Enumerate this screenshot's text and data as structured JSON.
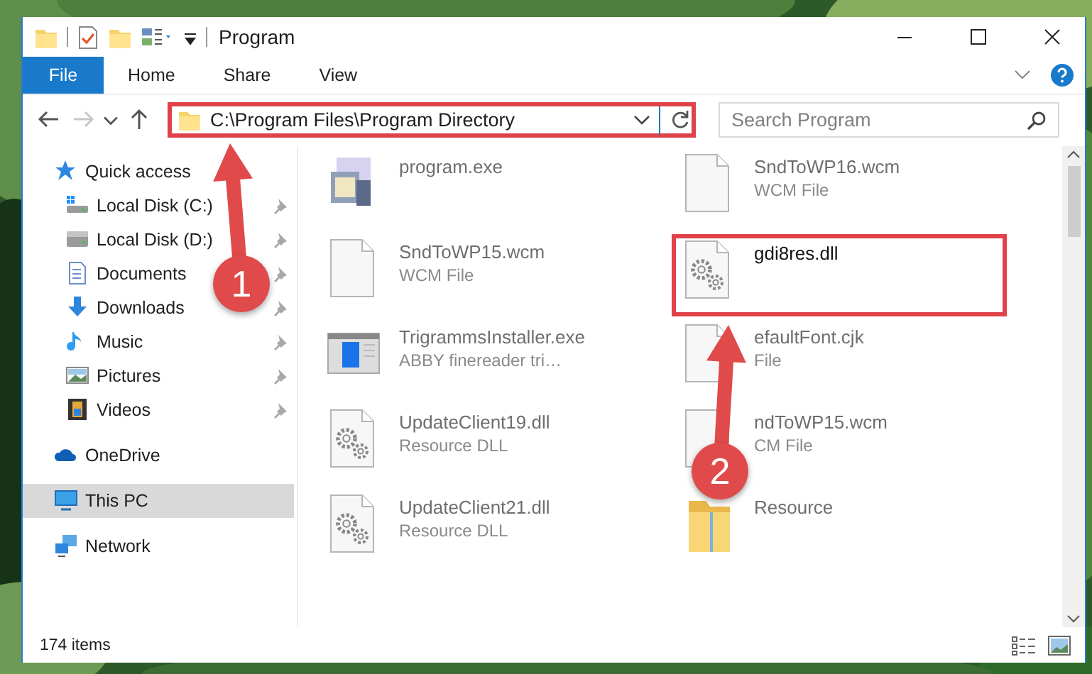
{
  "window": {
    "title": "Program"
  },
  "ribbon_tabs": [
    {
      "label": "File",
      "kind": "file"
    },
    {
      "label": "Home",
      "kind": "tab"
    },
    {
      "label": "Share",
      "kind": "tab"
    },
    {
      "label": "View",
      "kind": "tab"
    }
  ],
  "navigation": [
    {
      "kind": "back",
      "disabled": false
    },
    {
      "kind": "forward",
      "disabled": true
    },
    {
      "kind": "recent",
      "disabled": false
    },
    {
      "kind": "up",
      "disabled": false
    }
  ],
  "address_bar": {
    "path": "C:\\Program Files\\Program Directory",
    "highlighted": true
  },
  "search": {
    "placeholder": "Search Program"
  },
  "sidebar": {
    "items": [
      {
        "label": "Quick access",
        "kind": "star",
        "selected": false,
        "children": [
          {
            "label": "Local Disk (C:)",
            "kind": "system-drive",
            "pinned": true,
            "selected": false
          },
          {
            "label": "Local Disk (D:)",
            "kind": "drive",
            "pinned": true,
            "selected": false
          },
          {
            "label": "Documents",
            "kind": "documents",
            "pinned": true,
            "selected": false
          },
          {
            "label": "Downloads",
            "kind": "downloads",
            "pinned": true,
            "selected": false
          },
          {
            "label": "Music",
            "kind": "music",
            "pinned": true,
            "selected": false
          },
          {
            "label": "Pictures",
            "kind": "pictures",
            "pinned": true,
            "selected": false
          },
          {
            "label": "Videos",
            "kind": "videos",
            "pinned": true,
            "selected": false
          }
        ]
      },
      {
        "label": "OneDrive",
        "kind": "cloud",
        "selected": false
      },
      {
        "label": "This PC",
        "kind": "computer",
        "selected": true
      },
      {
        "label": "Network",
        "kind": "network",
        "selected": false
      }
    ]
  },
  "files": [
    {
      "name": "program.exe",
      "kind": "program",
      "blurred": true,
      "highlighted": false
    },
    {
      "name": "SndToWP16.wcm",
      "type": "WCM File",
      "kind": "document",
      "blurred": true,
      "highlighted": false
    },
    {
      "name": "SndToWP15.wcm",
      "type": "WCM File",
      "kind": "document",
      "blurred": true,
      "highlighted": false
    },
    {
      "name": "gdi8res.dll",
      "kind": "gear-document",
      "blurred": false,
      "highlighted": true
    },
    {
      "name": "TrigrammsInstaller.exe",
      "type": "ABBY finereader tri…",
      "kind": "installer",
      "blurred": true,
      "highlighted": false
    },
    {
      "name": "efaultFont.cjk",
      "type": "File",
      "kind": "document",
      "blurred": true,
      "highlighted": false
    },
    {
      "name": "UpdateClient19.dll",
      "type": "Resource DLL",
      "kind": "gear-document",
      "blurred": true,
      "highlighted": false
    },
    {
      "name": "ndToWP15.wcm",
      "type": "CM File",
      "kind": "document",
      "blurred": true,
      "highlighted": false
    },
    {
      "name": "UpdateClient21.dll",
      "type": "Resource DLL",
      "kind": "gear-document",
      "blurred": true,
      "highlighted": false
    },
    {
      "name": "Resource",
      "kind": "folder",
      "blurred": true,
      "highlighted": false
    }
  ],
  "status_bar": {
    "item_count": "174 items"
  },
  "annotations": [
    {
      "number": "1"
    },
    {
      "number": "2"
    }
  ]
}
